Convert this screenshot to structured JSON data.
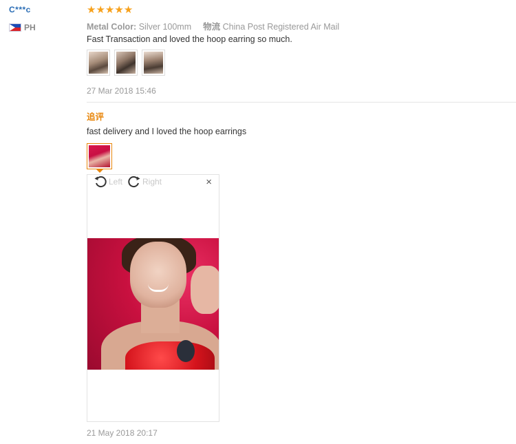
{
  "reviewer": {
    "name": "C***c",
    "country_code": "PH",
    "flag": "philippines-flag"
  },
  "review": {
    "rating": 5,
    "stars": [
      "★",
      "★",
      "★",
      "★",
      "★"
    ],
    "metal_color_label": "Metal Color:",
    "metal_color_value": "Silver 100mm",
    "shipping_label": "物流",
    "shipping_value": "China Post Registered Air Mail",
    "text": "Fast Transaction and loved the hoop earring so much.",
    "date": "27 Mar 2018 15:46"
  },
  "follow_up": {
    "title": "追评",
    "text": "fast delivery and I loved the hoop earrings",
    "date": "21 May 2018 20:17"
  },
  "viewer": {
    "rotate_left_label": "Left",
    "rotate_right_label": "Right",
    "close_glyph": "×"
  },
  "colors": {
    "accent": "#e8860b",
    "star": "#f7a11c",
    "name": "#2a6db5"
  }
}
